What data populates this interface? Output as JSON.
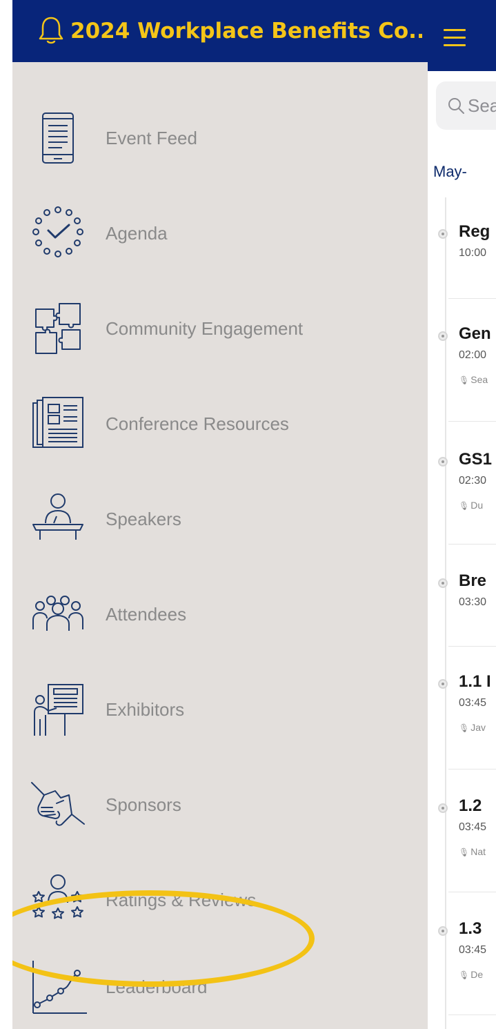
{
  "drawer": {
    "title": "2024 Workplace Benefits Co...",
    "items": [
      {
        "label": "Event Feed",
        "icon": "tablet-icon"
      },
      {
        "label": "Agenda",
        "icon": "clock-check-icon"
      },
      {
        "label": "Community Engagement",
        "icon": "puzzle-icon"
      },
      {
        "label": "Conference Resources",
        "icon": "documents-icon"
      },
      {
        "label": "Speakers",
        "icon": "podium-speaker-icon"
      },
      {
        "label": "Attendees",
        "icon": "people-group-icon"
      },
      {
        "label": "Exhibitors",
        "icon": "presenter-board-icon"
      },
      {
        "label": "Sponsors",
        "icon": "handshake-icon"
      },
      {
        "label": "Ratings & Reviews",
        "icon": "person-stars-icon"
      },
      {
        "label": "Leaderboard",
        "icon": "line-chart-icon"
      }
    ]
  },
  "main": {
    "search_placeholder": "Sea",
    "date_label": "May-",
    "sessions": [
      {
        "title": "Reg",
        "time": "10:00",
        "speaker": ""
      },
      {
        "title": "Gen",
        "time": "02:00",
        "speaker": "Sea"
      },
      {
        "title": "GS1",
        "time": "02:30",
        "speaker": "Du"
      },
      {
        "title": "Bre",
        "time": "03:30",
        "speaker": ""
      },
      {
        "title": "1.1 I",
        "time": "03:45",
        "speaker": "Jav"
      },
      {
        "title": "1.2",
        "time": "03:45",
        "speaker": "Nat"
      },
      {
        "title": "1.3",
        "time": "03:45",
        "speaker": "De"
      }
    ]
  },
  "colors": {
    "header_bg": "#08257a",
    "title_gold": "#f4c518",
    "drawer_bg": "#e3dfdc",
    "icon_stroke": "#1f3a6b",
    "highlight_ring": "#f3c215"
  }
}
